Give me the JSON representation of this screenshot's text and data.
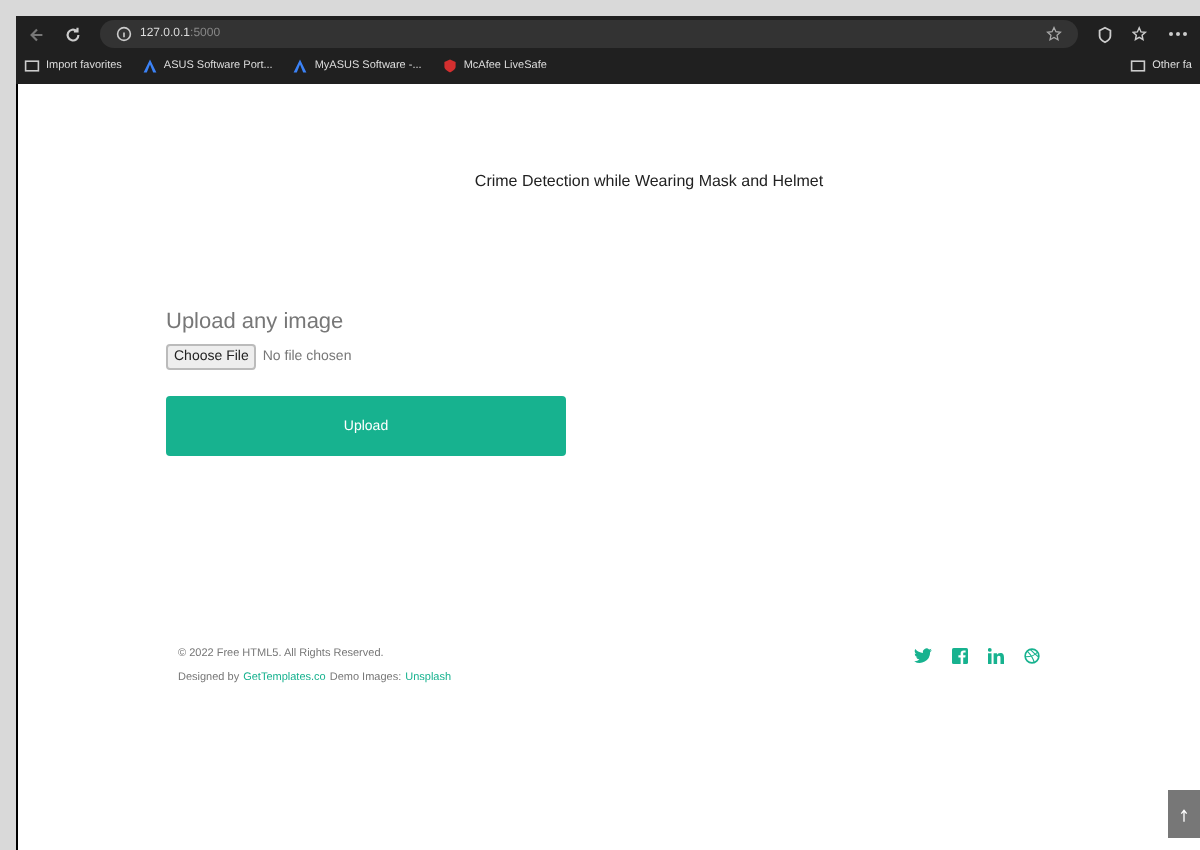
{
  "browser": {
    "url_host": "127.0.0.1",
    "url_port": ":5000",
    "bookmarks": [
      {
        "label": "Import favorites",
        "kind": "folder"
      },
      {
        "label": "ASUS Software Port...",
        "kind": "asus"
      },
      {
        "label": "MyASUS Software -...",
        "kind": "asus"
      },
      {
        "label": "McAfee LiveSafe",
        "kind": "shield"
      }
    ],
    "other": "Other fa"
  },
  "page": {
    "title": "Crime Detection while Wearing Mask and Helmet",
    "upload_heading": "Upload any image",
    "file_button": "Choose File",
    "file_status": "No file chosen",
    "upload_button": "Upload"
  },
  "footer": {
    "copyright": "© 2022 Free HTML5. All Rights Reserved.",
    "designed_prefix": "Designed by",
    "designed_link": "GetTemplates.co",
    "demo_prefix": "Demo Images:",
    "demo_link": "Unsplash",
    "social": [
      {
        "kind": "twitter"
      },
      {
        "kind": "facebook"
      },
      {
        "kind": "linkedin"
      },
      {
        "kind": "dribbble"
      }
    ]
  }
}
